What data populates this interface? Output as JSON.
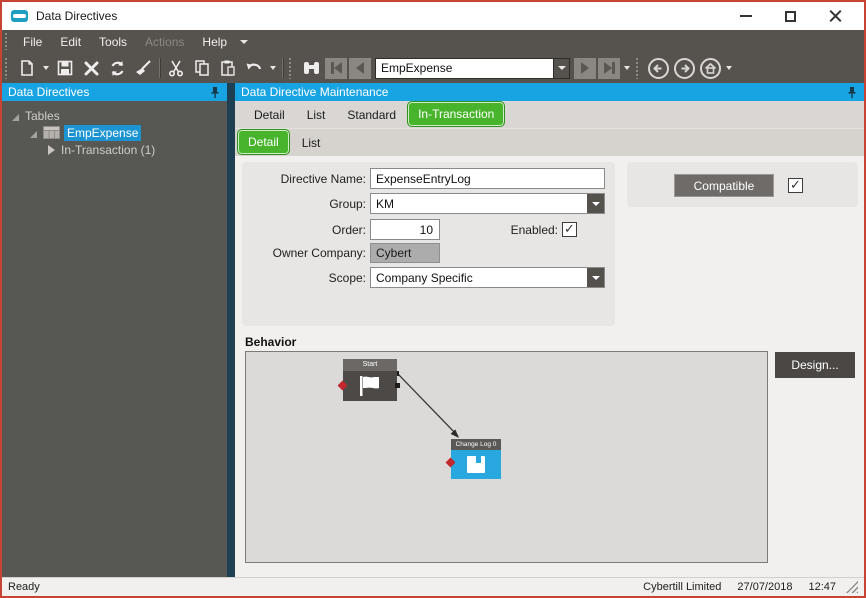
{
  "window": {
    "title": "Data Directives"
  },
  "menu": {
    "items": [
      {
        "label": "File",
        "enabled": true
      },
      {
        "label": "Edit",
        "enabled": true
      },
      {
        "label": "Tools",
        "enabled": true
      },
      {
        "label": "Actions",
        "enabled": false
      },
      {
        "label": "Help",
        "enabled": true
      }
    ]
  },
  "toolbar": {
    "icons": [
      "new-document",
      "save",
      "delete",
      "refresh",
      "clean",
      "cut",
      "copy",
      "paste",
      "undo",
      "find",
      "nav-first",
      "nav-previous",
      "nav-next",
      "nav-last",
      "back",
      "forward",
      "home"
    ],
    "record_combo_value": "EmpExpense"
  },
  "left_panel": {
    "header": "Data Directives",
    "tree": [
      {
        "label": "Tables",
        "level": 0,
        "state": "expanded",
        "selected": false
      },
      {
        "label": "EmpExpense",
        "level": 1,
        "state": "expanded",
        "selected": true,
        "icon": "table-icon"
      },
      {
        "label": "In-Transaction (1)",
        "level": 2,
        "state": "collapsed",
        "selected": false
      }
    ]
  },
  "right_panel": {
    "header": "Data Directive Maintenance",
    "tabs": [
      {
        "label": "Detail",
        "selected": false
      },
      {
        "label": "List",
        "selected": false
      },
      {
        "label": "Standard",
        "selected": false
      },
      {
        "label": "In-Transaction",
        "selected": true
      }
    ],
    "subtabs": [
      {
        "label": "Detail",
        "selected": true
      },
      {
        "label": "List",
        "selected": false
      }
    ],
    "form": {
      "directive_name": {
        "label": "Directive Name:",
        "value": "ExpenseEntryLog"
      },
      "group": {
        "label": "Group:",
        "value": "KM"
      },
      "order": {
        "label": "Order:",
        "value": "10"
      },
      "enabled": {
        "label": "Enabled:",
        "checked": true
      },
      "owner_company": {
        "label": "Owner Company:",
        "value": "Cybert"
      },
      "scope": {
        "label": "Scope:",
        "value": "Company Specific"
      }
    },
    "compatible": {
      "button_label": "Compatible",
      "checked": true
    },
    "behavior": {
      "section_label": "Behavior",
      "design_button": "Design...",
      "nodes": [
        {
          "title": "Start",
          "type": "start-flag"
        },
        {
          "title": "Change Log 0",
          "type": "change-log"
        }
      ]
    }
  },
  "status_bar": {
    "status": "Ready",
    "company": "Cybertill Limited",
    "date": "27/07/2018",
    "time": "12:47"
  },
  "colors": {
    "accent_blue": "#18A3E3",
    "accent_green": "#47B42C",
    "chrome_dark": "#56524D",
    "window_border_red": "#C74333",
    "selection_blue": "#1D94D2",
    "node_blue": "#29A8E0",
    "splitter_teal": "#1E4052"
  }
}
